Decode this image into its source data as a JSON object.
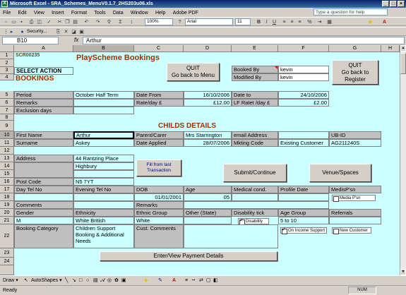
{
  "window": {
    "title": "Microsoft Excel - SRA_Schemes_MenuV0.1.7_2HS203u06.xls",
    "app_icon": "X"
  },
  "menu": {
    "items": [
      "File",
      "Edit",
      "View",
      "Insert",
      "Format",
      "Tools",
      "Data",
      "Window",
      "Help",
      "Adobe PDF"
    ],
    "help_placeholder": "Type a question for help"
  },
  "toolbar": {
    "zoom": "100%",
    "font": "Arial",
    "font_size": "11",
    "security_label": "Security..."
  },
  "formula": {
    "cell": "B10",
    "fx": "fx",
    "content": "Arthur"
  },
  "columns": [
    "A",
    "B",
    "C",
    "D",
    "E",
    "F",
    "G",
    "H"
  ],
  "rows": [
    "1",
    "2",
    "3",
    "4",
    "5",
    "6",
    "7",
    "8",
    "9",
    "10",
    "11",
    "12",
    "13",
    "14",
    "15",
    "16",
    "17",
    "18",
    "19",
    "20",
    "21",
    "22",
    "23",
    "24"
  ],
  "sheet": {
    "scr": "SCR00235",
    "title": "PlayScheme Bookings",
    "select_action": "SELECT ACTION",
    "bookings": "BOOKINGS",
    "quit1": "QUIT\nGo back to Menu",
    "booked_by_label": "Booked By",
    "booked_by": "kevin",
    "modified_by_label": "Modified By",
    "modified_by": "kevin",
    "quit2": "QUIT\nGo back to Register",
    "period_label": "Period",
    "period": "October Half Term",
    "date_from_label": "Date From",
    "date_from": "16/10/2006",
    "date_to_label": "Date to",
    "date_to": "24/10/2006",
    "remarks_label": "Remarks",
    "rate_label": "Rate/day £",
    "rate": "£12.00",
    "lf_rate_label": "LF Ratet /day £",
    "lf_rate": "£2.00",
    "exclusion_label": "Exclusion days",
    "childs_details": "CHILDS DETAILS",
    "first_name_label": "First Name",
    "first_name": "Arthur",
    "parent_label": "Parent/Carer",
    "parent": "Mrs Starrington",
    "email_label": "email Address",
    "ubid_label": "UB-ID",
    "surname_label": "Surname",
    "surname": "Askey",
    "date_applied_label": "Date Applied",
    "date_applied": "28/07/2006",
    "mkting_label": "Mkting Code",
    "mkting": "Existing Customer",
    "ubid": "AG211240S",
    "address_label": "Address",
    "address1": "44 Rantzing Place",
    "address2": "Highbury",
    "fill_btn": "Fill from last Transaction",
    "submit_btn": "Submit/Continue",
    "venue_btn": "Venue/Spaces",
    "postcode_label": "Post Code",
    "postcode": "N5 7YT",
    "day_tel_label": "Day Tel No",
    "eve_tel_label": "Evening Tel No",
    "dob_label": "DOB",
    "age_label": "Age",
    "medical_label": "Medical cond.",
    "profile_label": "Profile Date",
    "medis_label": "MedisP'sn",
    "dob": "01/01/2001",
    "age": "05",
    "media_psn": "Media P'sn",
    "comments_label": "Comments",
    "remarks2_label": "Remarks",
    "gender_label": "Gender",
    "ethnicity_label": "Ethnicity",
    "ethnic_group_label": "Ethnic Group",
    "other_state_label": "Other (State)",
    "disability_tick_label": "Disability tick",
    "age_group_label": "Age Group",
    "referrals_label": "Referrals",
    "gender": "M",
    "ethnicity": "White British",
    "ethnic_group": "White",
    "disability_chk": "Disability",
    "age_group": "5 to 10",
    "booking_cat_label": "Booking Category",
    "booking_cat": "Children Support Booking & Additional Needs",
    "cust_comments_label": "Cust. Comments",
    "income_chk": "On Income Support",
    "new_cust_chk": "New Customer",
    "payment_btn": "Enter/View Payment Details"
  },
  "drawbar": {
    "draw": "Draw ▾",
    "autoshapes": "AutoShapes ▾"
  },
  "status": {
    "left": "Ready",
    "right": "NUM"
  },
  "colors": {
    "grid_bg": "#ccffff",
    "title": "#993300",
    "label_bg": "#c0c0c0"
  }
}
